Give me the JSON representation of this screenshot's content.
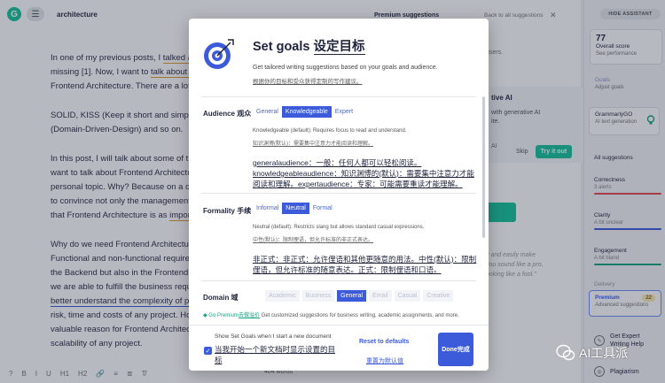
{
  "editor": {
    "doc_title": "architecture",
    "paragraphs": [
      [
        "In one of my previous posts, I ",
        "talked a",
        ""
      ],
      [
        "missing [1]. Now, I want to ",
        "talk about a",
        ""
      ],
      [
        "Frontend Architecture. There are a lot",
        "",
        ""
      ],
      [
        "SOLID, KISS (Keep it short and simple",
        "",
        ""
      ],
      [
        "(Domain-Driven-Design) and so on.",
        "",
        ""
      ],
      [
        "In this post, I will talk about some of t",
        "",
        ""
      ],
      [
        "want to talk about Frontend Architectu",
        "",
        ""
      ],
      [
        "personal topic. Why? Because on a da",
        "",
        ""
      ],
      [
        "to convince not only the management",
        "",
        ""
      ],
      [
        "that Frontend Architecture is as ",
        "impor",
        ""
      ],
      [
        "Why do we need Frontend Architectur",
        "",
        ""
      ],
      [
        "Functional and non-functional requirer",
        "",
        ""
      ],
      [
        "the Backend but also in the Frontend.",
        "",
        ""
      ],
      [
        "we are able to fulfill the business requ",
        "",
        ""
      ],
      [
        "",
        "better understand the complexity of p",
        ""
      ],
      [
        "risk, time and costs of any project. How",
        "",
        ""
      ],
      [
        "valuable reason for Frontend Architect",
        "",
        ""
      ],
      [
        "scalability of any project.",
        "",
        ""
      ]
    ],
    "word_count": "404 words",
    "toolbar": [
      "B",
      "I",
      "U",
      "H1",
      "H2",
      "🔗",
      "≡",
      "≣",
      "T̸"
    ]
  },
  "suggestions": {
    "header": "Premium suggestions",
    "back": "Back to all suggestions",
    "partial_user": "users.",
    "gen_title": "tive AI",
    "gen_text1": "with generative AI",
    "gen_text2": "ite.",
    "gen_ai": "AI",
    "skip": "Skip",
    "try_it": "Try it out",
    "faint1": "y and easily make",
    "faint2": "you sound like a pro,",
    "faint3": "ooking like a fool.\""
  },
  "sidebar": {
    "hide": "HIDE ASSISTANT",
    "score": "77",
    "score_label": "Overall score",
    "score_sub": "See performance",
    "goals": "Goals",
    "goals_sub": "Adjust goals",
    "ggo": "GrammarlyGO",
    "ggo_sub": "AI text generation",
    "all": "All suggestions",
    "correctness": "Correctness",
    "correctness_sub": "3 alerts",
    "clarity": "Clarity",
    "clarity_sub": "A bit unclear",
    "engagement": "Engagement",
    "engagement_sub": "A bit bland",
    "delivery": "Delivery",
    "premium": "Premium",
    "premium_sub": "Advanced suggestions",
    "premium_count": "22",
    "expert1": "Get Expert",
    "expert2": "Writing Help",
    "plagiarism": "Plagiarism",
    "colors": {
      "correctness": "#e5484d",
      "clarity": "#3b5bdb",
      "engagement": "#15a37f"
    }
  },
  "modal": {
    "title_en": "Set goals",
    "title_cn": "设定目标",
    "subtitle_en": "Get tailored writing suggestions based on your goals and audience.",
    "subtitle_cn": "根据你的目标和受众获得定制的写作建议。",
    "audience": {
      "label": "Audience 观众",
      "options": [
        "General",
        "Knowledgeable",
        "Expert"
      ],
      "selected": "Knowledgeable",
      "desc_en": "Knowledgeable (default): Requires focus to read and understand.",
      "desc_cn": "知识渊博(默认)：需要集中注意力才能阅读和理解。",
      "big_cn": "generalaudience：一般：任何人都可以轻松阅读。knowledgeableaudience：知识渊博的(默认)：需要集中注意力才能阅读和理解。expertaudience：专家：可能需要重读才能理解。"
    },
    "formality": {
      "label": "Formality 手续",
      "options": [
        "Informal",
        "Neutral",
        "Formal"
      ],
      "selected": "Neutral",
      "desc_en": "Neutral (default): Restricts slang but allows standard casual expressions.",
      "desc_cn": "中性(默认)：限制俚语，但允许标准的非正式表达。",
      "big_cn": "非正式：非正式：允许俚语和其他更随意的用法。中性(默认)：限制俚语，但允许标准的随意表达。正式：限制俚语和口语。"
    },
    "domain": {
      "label": "Domain 域",
      "options": [
        "Academic",
        "Business",
        "General",
        "Email",
        "Casual",
        "Creative"
      ],
      "selected": "General"
    },
    "premium_note_pre": "Go Premium",
    "premium_note_cn": "去做溢价",
    "premium_note_rest": " Get customized suggestions for business writing, academic assignments, and more.",
    "checkbox_en": "Show Set Goals when I start a new document",
    "checkbox_cn": "当我开始一个新文档时显示设置的目标",
    "reset_en": "Reset to defaults",
    "reset_cn": "重置为默认值",
    "done": "Done完成"
  },
  "watermark": "AI工具派"
}
